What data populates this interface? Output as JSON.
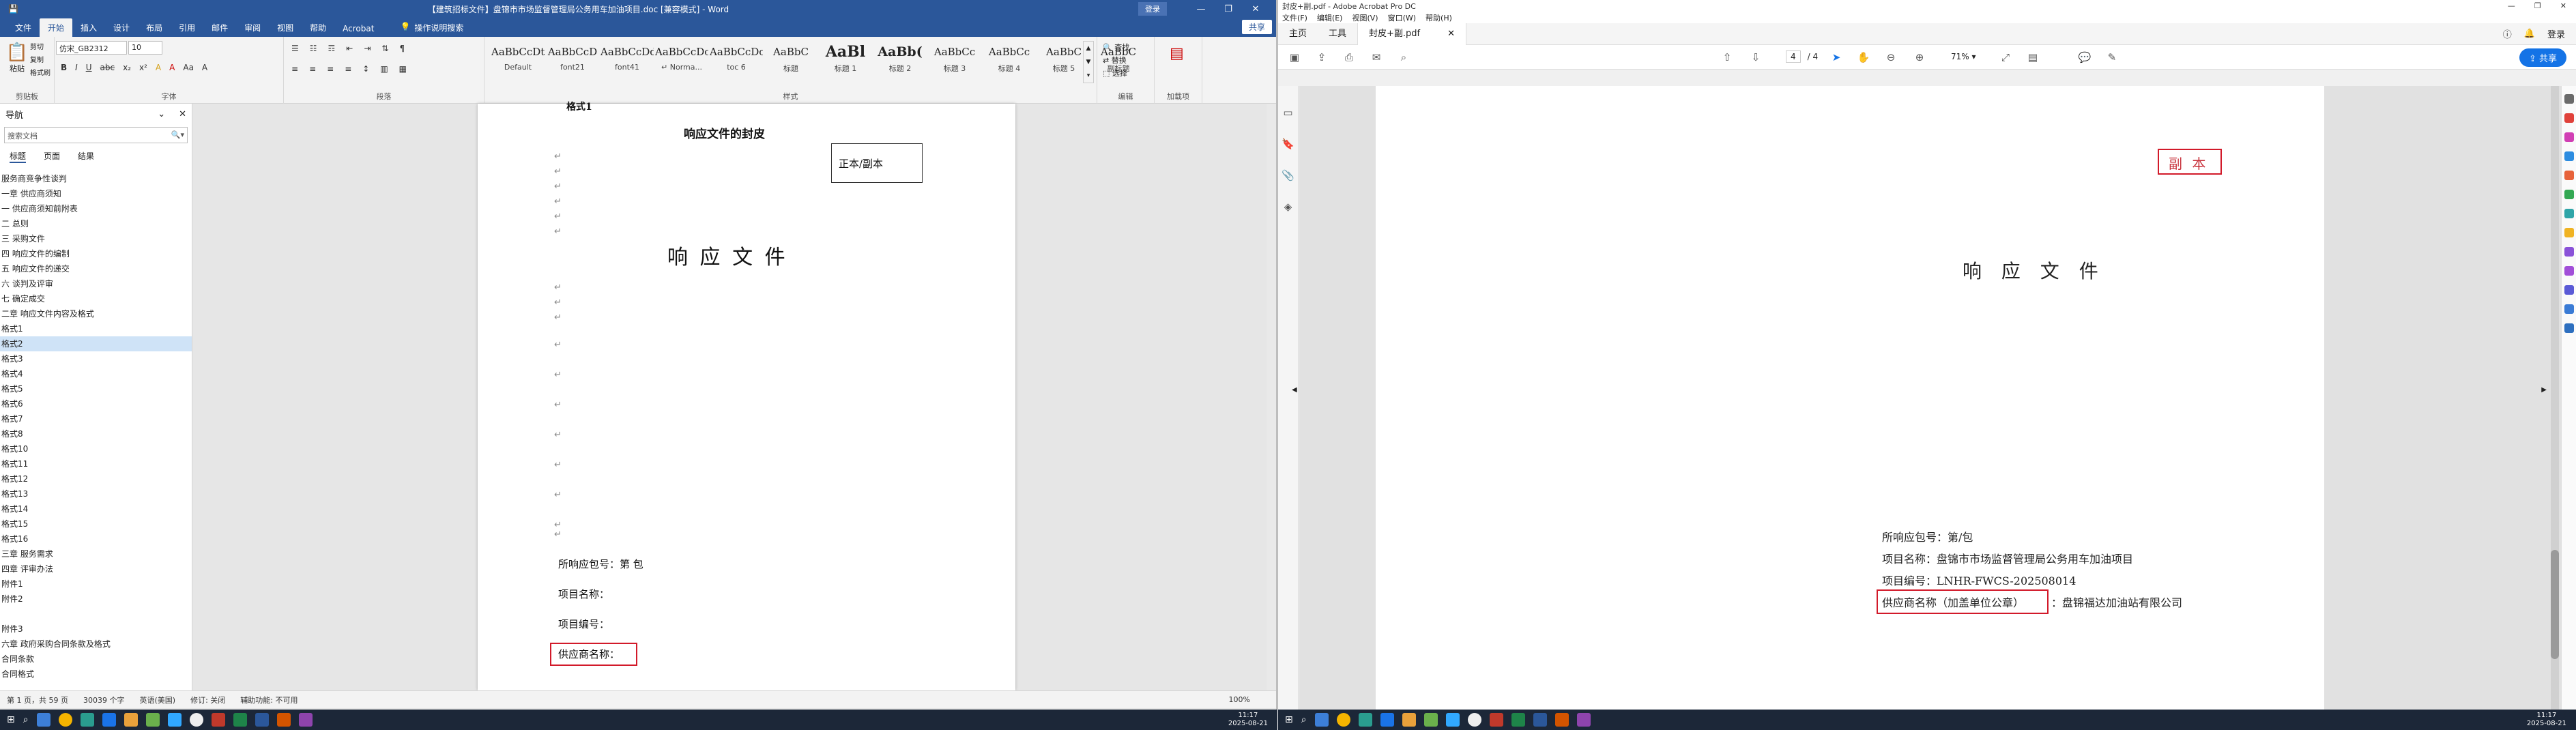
{
  "word": {
    "title": "【建筑招标文件】盘锦市市场监督管理局公务用车加油项目.doc [兼容模式] - Word",
    "login_label": "登录",
    "window_controls": [
      "—",
      "❐",
      "✕"
    ],
    "tabs": [
      "文件",
      "开始",
      "插入",
      "设计",
      "布局",
      "引用",
      "邮件",
      "审阅",
      "视图",
      "帮助",
      "Acrobat"
    ],
    "active_tab": "开始",
    "tell_me": "操作说明搜索",
    "share_label": "共享",
    "ribbon": {
      "clipboard": {
        "label": "剪贴板",
        "paste": "粘贴",
        "cut": "剪切",
        "copy": "复制",
        "format_painter": "格式刷"
      },
      "font": {
        "label": "字体",
        "font_name": "仿宋_GB2312",
        "font_size": "10",
        "buttons": [
          "B",
          "I",
          "U",
          "abc",
          "x₂",
          "x²",
          "A",
          "A",
          "Aa",
          "A"
        ]
      },
      "paragraph": {
        "label": "段落",
        "buttons": [
          "≡",
          "≡",
          "≡",
          "≡",
          "↕",
          "¶"
        ]
      },
      "styles": {
        "label": "样式",
        "items": [
          {
            "preview": "AaBbCcDt",
            "name": "Default"
          },
          {
            "preview": "AaBbCcD",
            "name": "font21"
          },
          {
            "preview": "AaBbCcDd",
            "name": "font41"
          },
          {
            "preview": "AaBbCcDc",
            "name": "↵ Norma..."
          },
          {
            "preview": "AaBbCcDc",
            "name": "toc 6"
          },
          {
            "preview": "AaBbC",
            "name": "标题"
          },
          {
            "preview": "AaBl",
            "name": "标题 1"
          },
          {
            "preview": "AaBb(",
            "name": "标题 2"
          },
          {
            "preview": "AaBbCc",
            "name": "标题 3"
          },
          {
            "preview": "AaBbCc",
            "name": "标题 4"
          },
          {
            "preview": "AaBbC",
            "name": "标题 5"
          },
          {
            "preview": "AaBbC",
            "name": "副标题"
          }
        ]
      },
      "editing": {
        "label": "编辑",
        "find": "查找",
        "replace": "替换",
        "select": "选择"
      },
      "acrobat": {
        "label": "加载项"
      }
    },
    "nav": {
      "title": "导航",
      "search_placeholder": "搜索文档",
      "view_tabs": [
        "标题",
        "页面",
        "结果"
      ],
      "items": [
        "服务商竞争性谈判",
        "一章 供应商须知",
        "一 供应商须知前附表",
        "二 总则",
        "三 采购文件",
        "四 响应文件的编制",
        "五 响应文件的递交",
        "六 谈判及评审",
        "七 确定成交",
        "二章 响应文件内容及格式",
        "格式1",
        "格式2",
        "格式3",
        "格式4",
        "格式5",
        "格式6",
        "格式7",
        "格式8",
        "格式10",
        "格式11",
        "格式12",
        "格式13",
        "格式14",
        "格式15",
        "格式16",
        "三章 服务需求",
        "四章 评审办法",
        "附件1",
        "附件2",
        "",
        "附件3",
        "六章 政府采购合同条款及格式",
        "合同条款",
        "合同格式"
      ],
      "selected_index": 11
    },
    "doc": {
      "top_cut": "格式1",
      "cover_title": "响应文件的封皮",
      "copy_box": "正本/副本",
      "main_title": "响 应 文 件",
      "fields": [
        "所响应包号：第 包",
        "项目名称：",
        "项目编号：",
        "供应商名称："
      ],
      "para_mark": "↵"
    },
    "status": {
      "page": "第 1 页，共 59 页",
      "words": "30039 个字",
      "lang": "英语(美国)",
      "track": "修订: 关闭",
      "accessibility": "辅助功能: 不可用",
      "zoom": "100%"
    }
  },
  "acrobat": {
    "title": "封皮+副.pdf - Adobe Acrobat Pro DC",
    "menu": [
      "文件(F)",
      "编辑(E)",
      "视图(V)",
      "窗口(W)",
      "帮助(H)"
    ],
    "tabs": [
      "主页",
      "工具"
    ],
    "doc_tab": "封皮+副.pdf",
    "page_current": "4",
    "page_total": "/ 4",
    "zoom": "71%",
    "share_label": "共享",
    "login_label": "登录",
    "pdf": {
      "copy_label": "副 本",
      "main_title": "响 应 文 件",
      "lines": [
        "所响应包号：第/包",
        "项目名称：盘锦市市场监督管理局公务用车加油项目",
        "项目编号：LNHR-FWCS-202508014"
      ],
      "supplier_label": "供应商名称（加盖单位公章）",
      "supplier_value": "：盘锦福达加油站有限公司"
    },
    "highlight_color": "#d21a2a"
  },
  "taskbar_left": {
    "clock_time": "11:17",
    "clock_date": "2025-08-21"
  },
  "taskbar_right": {
    "clock_time": "11:17",
    "clock_date": "2025-08-21"
  }
}
